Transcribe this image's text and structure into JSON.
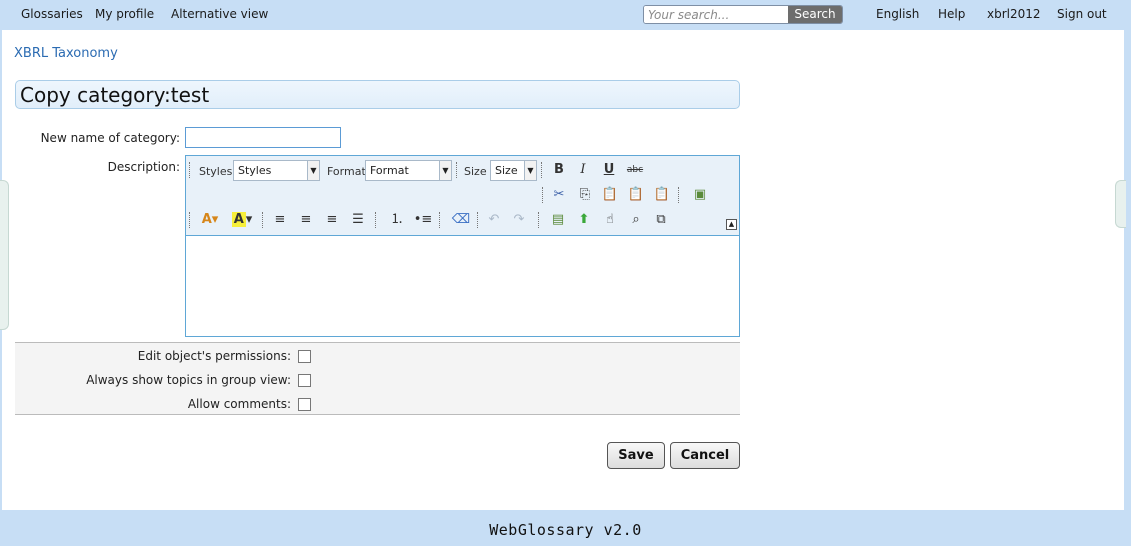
{
  "nav": {
    "glossaries": "Glossaries",
    "my_profile": "My profile",
    "alternative_view": "Alternative view",
    "search_placeholder": "Your search...",
    "search_button": "Search",
    "language": "English",
    "help": "Help",
    "username": "xbrl2012",
    "sign_out": "Sign out"
  },
  "breadcrumb": "XBRL Taxonomy",
  "page_title": "Copy category:test",
  "form": {
    "name_label": "New name of category:",
    "name_value": "",
    "description_label": "Description:"
  },
  "editor": {
    "styles_label": "Styles",
    "styles_value": "Styles",
    "format_label": "Format",
    "format_value": "Format",
    "size_label": "Size",
    "size_value": "Size",
    "bold": "B",
    "italic": "I",
    "underline": "U",
    "strike": "abc",
    "text_color": "A",
    "bg_color": "A"
  },
  "options": {
    "permissions_label": "Edit object's permissions:",
    "group_view_label": "Always show topics in group view:",
    "comments_label": "Allow comments:"
  },
  "buttons": {
    "save": "Save",
    "cancel": "Cancel"
  },
  "footer": "WebGlossary v2.0"
}
